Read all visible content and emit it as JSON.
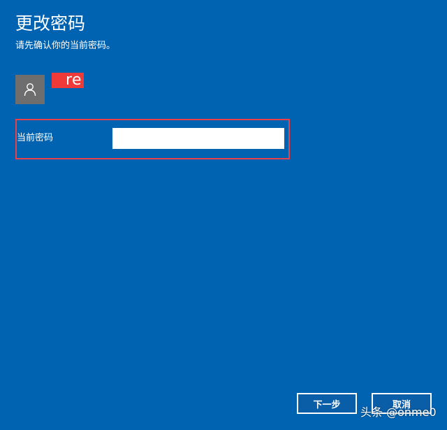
{
  "dialog": {
    "title": "更改密码",
    "subtitle": "请先确认你的当前密码。"
  },
  "account": {
    "avatar_icon": "person-icon",
    "username_visible": "re",
    "redaction_color": "#f03a3a"
  },
  "form": {
    "current_password_label": "当前密码",
    "current_password_value": "",
    "highlight_color": "#e8414a"
  },
  "buttons": {
    "next_label": "下一步",
    "cancel_label": "取消"
  },
  "watermark": {
    "text": "头条 @onme0"
  },
  "colors": {
    "background": "#0063b1",
    "avatar_bg": "#6e6e6e"
  }
}
